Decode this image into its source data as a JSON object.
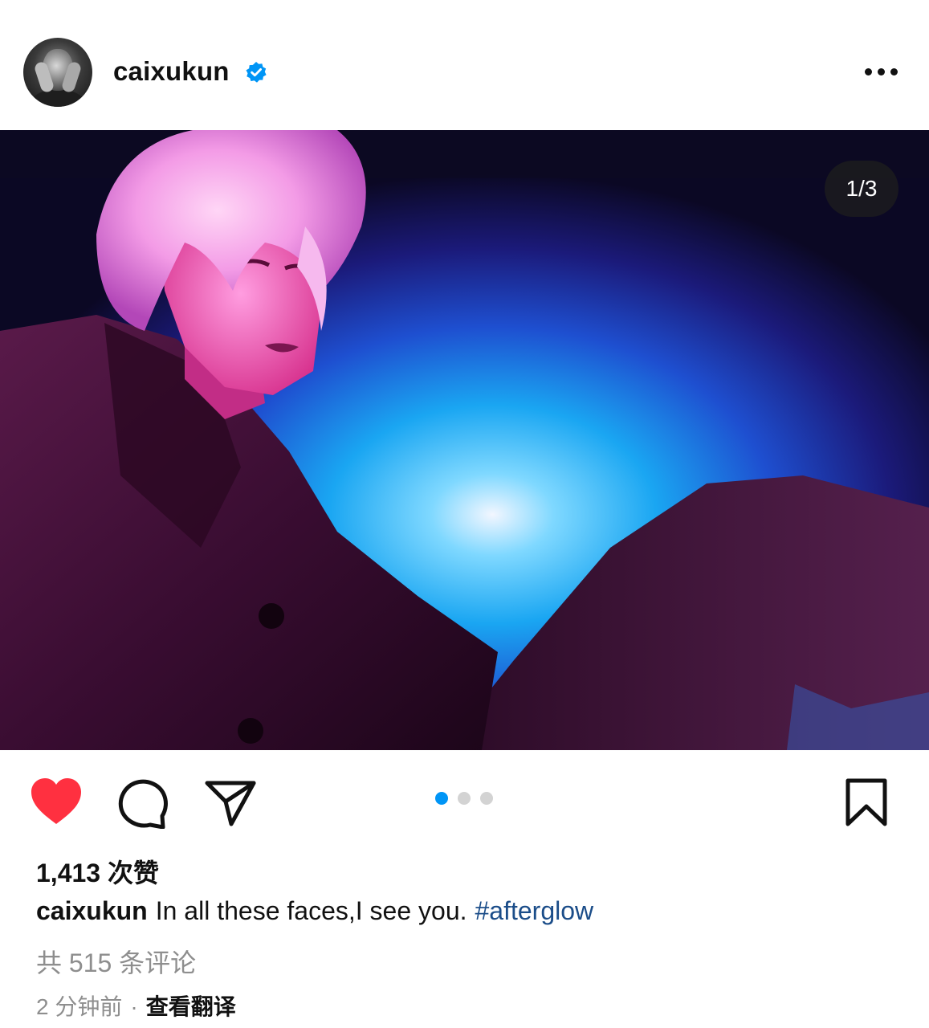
{
  "post": {
    "username": "caixukun",
    "verified": true,
    "more_icon": "more-horizontal-icon",
    "image_counter": "1/3",
    "carousel": {
      "current": 1,
      "total": 3
    },
    "liked": true,
    "likes_text": "1,413 次赞",
    "caption": {
      "username": "caixukun",
      "text": "In all these faces,I see you.",
      "hashtag": "#afterglow"
    },
    "comments_text": "共 515 条评论",
    "time_ago": "2 分钟前",
    "separator": "·",
    "translate_label": "查看翻译"
  },
  "icons": {
    "like": "heart-filled-icon",
    "comment": "comment-bubble-icon",
    "share": "paper-plane-icon",
    "save": "bookmark-icon",
    "verified": "verified-badge-icon"
  },
  "colors": {
    "like_red": "#ff3040",
    "verified_blue": "#0095f6",
    "hashtag_blue": "#1b4d89",
    "muted_gray": "#8e8e8e",
    "active_dot": "#0095f6",
    "inactive_dot": "#d3d3d3"
  }
}
